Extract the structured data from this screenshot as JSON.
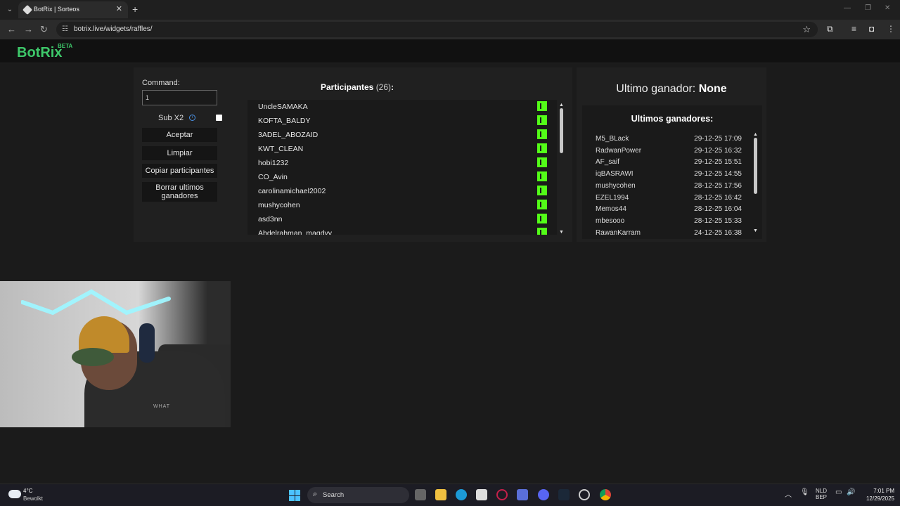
{
  "browser": {
    "tab_title": "BotRix | Sorteos",
    "new_tab": "+",
    "tab_close": "✕",
    "url": "botrix.live/widgets/raffles/"
  },
  "site": {
    "logo": "BotRix",
    "badge": "BETA"
  },
  "raffle": {
    "command_label": "Command:",
    "command_value": "1",
    "sub_label": "Sub X2",
    "sub_checked": false,
    "buttons": {
      "accept": "Aceptar",
      "clear": "Limpiar",
      "copy": "Copiar participantes",
      "clear_winners": "Borrar ultimos ganadores"
    }
  },
  "participants": {
    "title": "Participantes",
    "count": "(26)",
    "colon": ":",
    "items": [
      "UncleSAMAKA",
      "KOFTA_BALDY",
      "3ADEL_ABOZAID",
      "KWT_CLEAN",
      "hobi1232",
      "CO_Avin",
      "carolinamichael2002",
      "mushycohen",
      "asd3nn",
      "Abdelrahman_magdyy"
    ]
  },
  "winner_panel": {
    "last_label": "Ultimo ganador:",
    "last_value": "None",
    "list_title": "Ultimos ganadores:",
    "items": [
      {
        "name": "M5_BLack",
        "date": "29-12-25 17:09"
      },
      {
        "name": "RadwanPower",
        "date": "29-12-25 16:32"
      },
      {
        "name": "AF_saif",
        "date": "29-12-25 15:51"
      },
      {
        "name": "iqBASRAWI",
        "date": "29-12-25 14:55"
      },
      {
        "name": "mushycohen",
        "date": "28-12-25 17:56"
      },
      {
        "name": "EZEL1994",
        "date": "28-12-25 16:42"
      },
      {
        "name": "Memos44",
        "date": "28-12-25 16:04"
      },
      {
        "name": "mbesooo",
        "date": "28-12-25 15:33"
      },
      {
        "name": "RawanKarram",
        "date": "24-12-25 16:38"
      }
    ]
  },
  "webcam": {
    "shirt_text": "WHAT"
  },
  "taskbar": {
    "temp": "4°C",
    "condition": "Bewolkt",
    "search": "Search",
    "lang": "NLD",
    "lang2": "BEP",
    "time": "7:01 PM",
    "date": "12/29/2025"
  },
  "colors": {
    "brand": "#3ec86a",
    "kick": "#53fc18",
    "info": "#4a90e2"
  },
  "icons": [
    "chevron-down-icon",
    "reload-icon",
    "star-icon",
    "extensions-icon",
    "kick-icon",
    "info-icon",
    "windows-start-icon",
    "search-icon"
  ]
}
